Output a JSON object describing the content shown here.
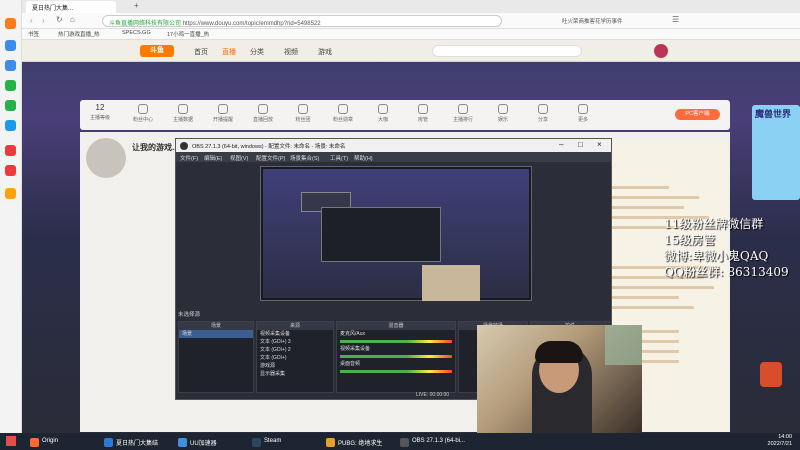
{
  "browser": {
    "tabs": [
      {
        "label": "夏日热门大集..."
      },
      {
        "label": "+"
      }
    ],
    "url": "https://www.douyu.com/topic/emmdhp?rid=5498522",
    "url_prefix": "斗鱼直播网络科技有限公司",
    "search_suggest": "吐火荣商推客花学历事件",
    "bookmarks": [
      {
        "label": "书签"
      },
      {
        "label": "热门游戏直播_热"
      },
      {
        "label": "SPECS.GG"
      },
      {
        "label": "17小鸡一直播_热"
      }
    ]
  },
  "douyu": {
    "logo": "斗鱼",
    "nav": [
      "首页",
      "直播",
      "分类",
      "视频",
      "游戏"
    ],
    "categories": [
      {
        "label": "主播等级",
        "count": "12"
      },
      {
        "label": "粉丝中心"
      },
      {
        "label": "主播数据"
      },
      {
        "label": "开播提醒"
      },
      {
        "label": "直播回放"
      },
      {
        "label": "粉丝团"
      },
      {
        "label": "粉丝勋章"
      },
      {
        "label": "大咖"
      },
      {
        "label": "房管"
      },
      {
        "label": "主播排行"
      },
      {
        "label": "娱乐"
      },
      {
        "label": "分享"
      },
      {
        "label": "更多"
      }
    ],
    "pc_button": "PC客户端",
    "room_title": "让我的游戏..."
  },
  "obs": {
    "title": "OBS 27.1.3 (64-bit, windows) - 配置文件: 未命名 - 场景: 未命名",
    "menu": [
      "文件(F)",
      "编辑(E)",
      "视图(V)",
      "配置文件(P)",
      "场景集合(S)",
      "工具(T)",
      "帮助(H)"
    ],
    "source_label": "未选择源",
    "docks": [
      {
        "title": "场景",
        "rows": [
          "场景"
        ]
      },
      {
        "title": "来源",
        "rows": [
          "视频采集设备",
          "文本 (GDI+) 3",
          "文本 (GDI+) 2",
          "文本 (GDI+)",
          "游戏源",
          "显示器采集"
        ]
      },
      {
        "title": "混音器",
        "rows": [
          "麦克风/Aux",
          "视频采集设备",
          "桌面音频"
        ]
      },
      {
        "title": "场景转场"
      },
      {
        "title": "控件"
      }
    ],
    "status": "LIVE: 00:00:00"
  },
  "overlay": {
    "lines": [
      "11级粉丝牌微信群",
      "15级房管",
      "微博:卑微小鬼QAQ",
      "QQ粉丝群: 86313409"
    ]
  },
  "ad": {
    "label": "魔兽世界"
  },
  "taskbar": {
    "items": [
      {
        "label": "Origin",
        "color": "#f56c2d"
      },
      {
        "label": "夏日热门大集结",
        "color": "#2b7bd6"
      },
      {
        "label": "UU加速器",
        "color": "#3f8fe0"
      },
      {
        "label": "Steam",
        "color": "#2a475e"
      },
      {
        "label": "PUBG: 绝地求生",
        "color": "#e6a12b"
      },
      {
        "label": "OBS 27.1.3 (64-bi...",
        "color": "#444"
      }
    ],
    "time": "14:00",
    "date": "2022/7/21"
  }
}
